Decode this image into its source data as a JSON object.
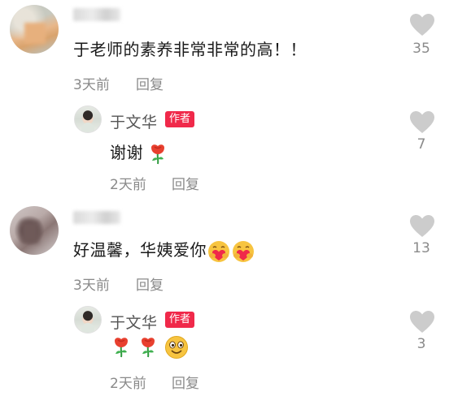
{
  "comments": [
    {
      "text": "于老师的素养非常非常的高！！",
      "time": "3天前",
      "reply_label": "回复",
      "likes": "35",
      "reply": {
        "author": "于文华",
        "badge": "作者",
        "text": "谢谢",
        "emojis": [
          "rose-emoji"
        ],
        "time": "2天前",
        "reply_label": "回复",
        "likes": "7"
      }
    },
    {
      "text": "好温馨，华姨爱你",
      "emojis": [
        "hug-heart-emoji",
        "hug-heart-emoji"
      ],
      "time": "3天前",
      "reply_label": "回复",
      "likes": "13",
      "reply": {
        "author": "于文华",
        "badge": "作者",
        "emojis": [
          "rose-emoji",
          "rose-emoji",
          "smile-emoji"
        ],
        "time": "2天前",
        "reply_label": "回复",
        "likes": "3"
      }
    }
  ],
  "colors": {
    "badge": "#f0294a",
    "like_icon": "#cccccc",
    "meta_text": "#8a8a8a"
  }
}
